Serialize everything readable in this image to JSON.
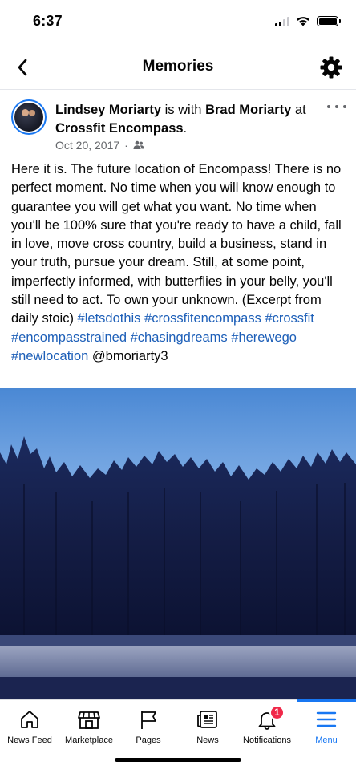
{
  "status_bar": {
    "time": "6:37"
  },
  "header": {
    "title": "Memories"
  },
  "post": {
    "author": "Lindsey Moriarty",
    "with_text": "is with",
    "tagged": "Brad Moriarty",
    "at_text": "at",
    "location": "Crossfit Encompass",
    "location_suffix": ".",
    "date": "Oct 20, 2017",
    "meta_sep": "·",
    "body": "Here it is. The future location of Encompass! There is no perfect moment. No time when  you will know enough to guarantee you will get what you want. No time when you'll be 100% sure that you're ready to have a child, fall in love, move cross country, build a business, stand in your truth, pursue your dream. Still, at some point, imperfectly informed, with butterflies in your belly, you'll still need to act. To own your unknown. (Excerpt from daily stoic)",
    "hashtags": [
      "#letsdothis",
      "#crossfitencompass",
      "#crossfit",
      "#encompasstrained",
      "#chasingdreams",
      "#herewego",
      "#newlocation"
    ],
    "mention": "@bmoriarty3"
  },
  "bottom_nav": {
    "items": [
      {
        "label": "News Feed",
        "icon": "home-icon"
      },
      {
        "label": "Marketplace",
        "icon": "shop-icon"
      },
      {
        "label": "Pages",
        "icon": "flag-icon"
      },
      {
        "label": "News",
        "icon": "newspaper-icon"
      },
      {
        "label": "Notifications",
        "icon": "bell-icon",
        "badge": "1"
      },
      {
        "label": "Menu",
        "icon": "menu-icon",
        "active": true
      }
    ]
  },
  "colors": {
    "accent": "#1877f2",
    "hashtag": "#1d5fb8",
    "badge": "#f02849",
    "meta": "#65676b"
  }
}
